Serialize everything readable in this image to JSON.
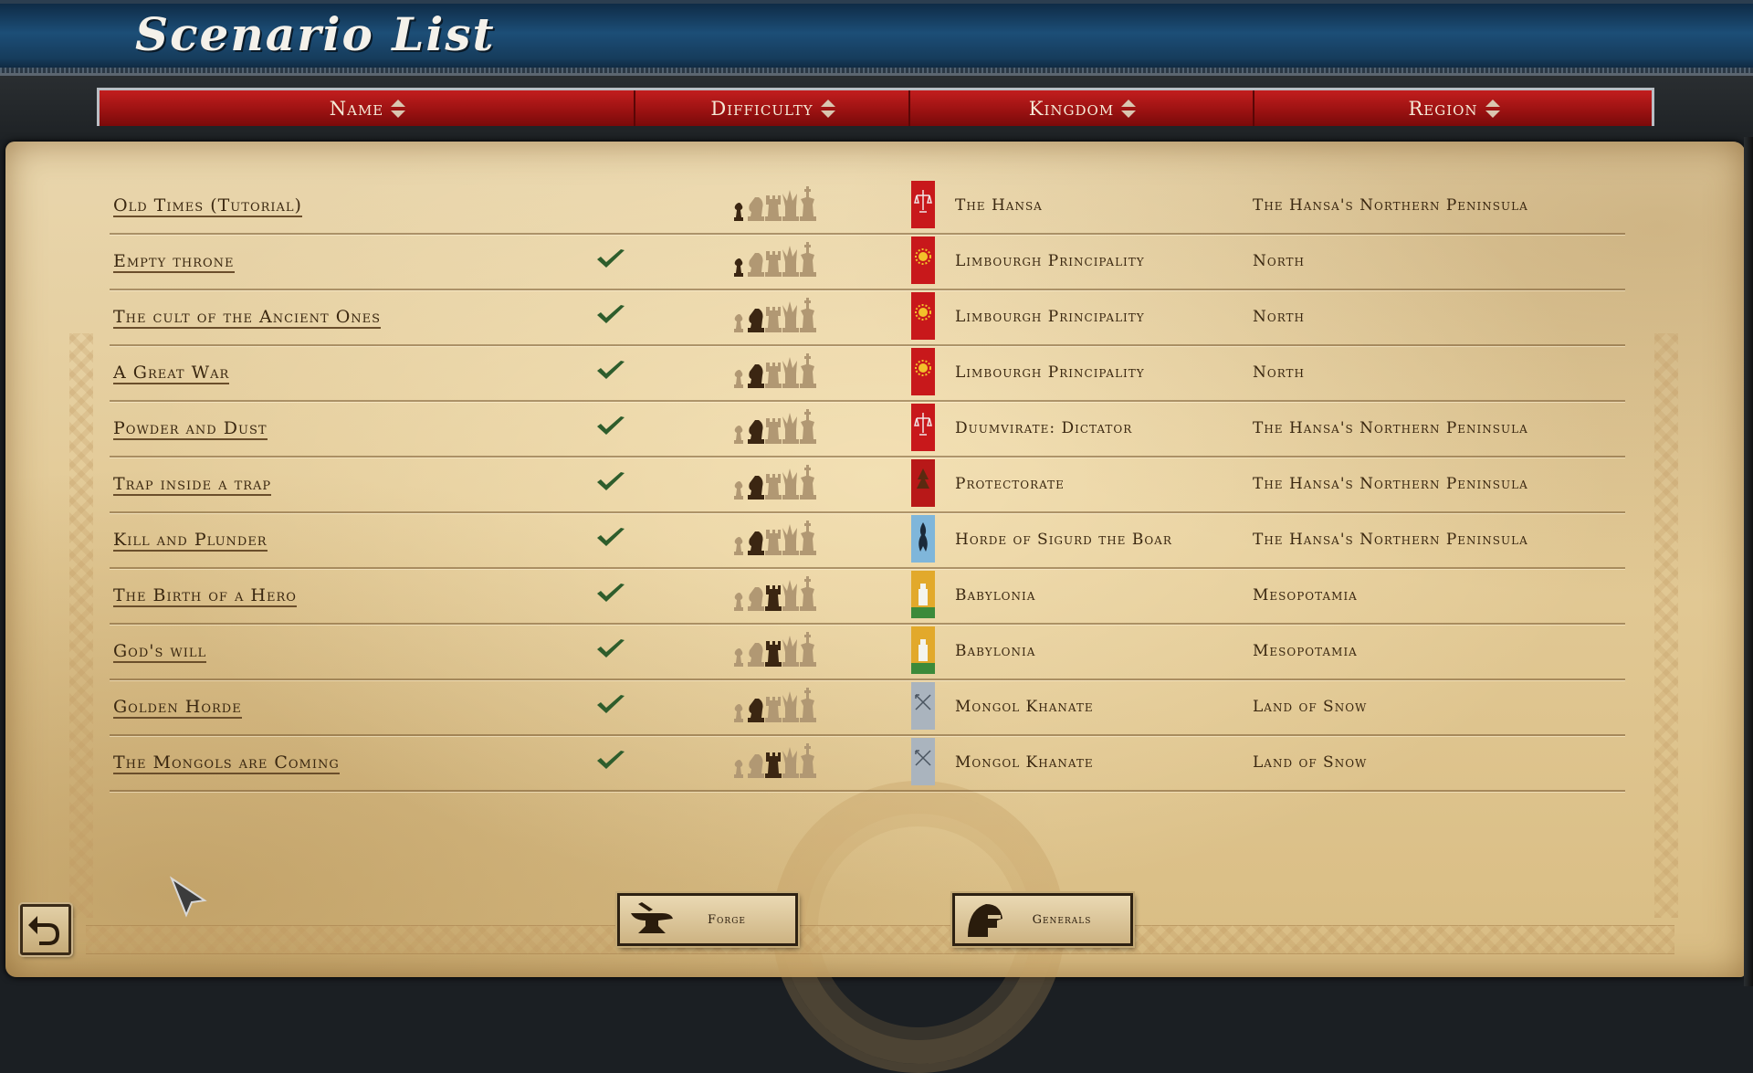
{
  "header": {
    "title": "Scenario List"
  },
  "columns": [
    {
      "label": "Name"
    },
    {
      "label": "Difficulty"
    },
    {
      "label": "Kingdom"
    },
    {
      "label": "Region"
    }
  ],
  "rows": [
    {
      "name": "Old Times (Tutorial)",
      "completed": false,
      "difficulty": 1,
      "banner_color": "#c8181b",
      "banner_icon": "scales-icon",
      "kingdom": "The Hansa",
      "region": "The Hansa's Northern Peninsula"
    },
    {
      "name": "Empty throne",
      "completed": true,
      "difficulty": 1,
      "banner_color": "#c8181b",
      "banner_icon": "sun-icon",
      "kingdom": "Limbourgh Principality",
      "region": "North"
    },
    {
      "name": "The cult of the Ancient Ones",
      "completed": true,
      "difficulty": 2,
      "banner_color": "#c8181b",
      "banner_icon": "sun-icon",
      "kingdom": "Limbourgh Principality",
      "region": "North"
    },
    {
      "name": "A Great War",
      "completed": true,
      "difficulty": 2,
      "banner_color": "#c8181b",
      "banner_icon": "sun-icon",
      "kingdom": "Limbourgh Principality",
      "region": "North"
    },
    {
      "name": "Powder and Dust",
      "completed": true,
      "difficulty": 2,
      "banner_color": "#c8181b",
      "banner_icon": "scales-icon",
      "kingdom": "Duumvirate: Dictator",
      "region": "The Hansa's Northern Peninsula"
    },
    {
      "name": "Trap inside a trap",
      "completed": true,
      "difficulty": 2,
      "banner_color": "#b81818",
      "banner_icon": "tree-icon",
      "kingdom": "Protectorate",
      "region": "The Hansa's Northern Peninsula"
    },
    {
      "name": "Kill and Plunder",
      "completed": true,
      "difficulty": 2,
      "banner_color": "#7fb6da",
      "banner_icon": "boar-icon",
      "kingdom": "Horde of Sigurd the Boar",
      "region": "The Hansa's Northern Peninsula"
    },
    {
      "name": "The Birth of a Hero",
      "completed": true,
      "difficulty": 3,
      "banner_color": "#e2a92b",
      "banner_icon": "tower-icon",
      "kingdom": "Babylonia",
      "region": "Mesopotamia"
    },
    {
      "name": "God's will",
      "completed": true,
      "difficulty": 3,
      "banner_color": "#e2a92b",
      "banner_icon": "tower-icon",
      "kingdom": "Babylonia",
      "region": "Mesopotamia"
    },
    {
      "name": "Golden Horde",
      "completed": true,
      "difficulty": 2,
      "banner_color": "#aab4be",
      "banner_icon": "arrows-icon",
      "kingdom": "Mongol Khanate",
      "region": "Land of Snow"
    },
    {
      "name": "The Mongols are Coming",
      "completed": true,
      "difficulty": 3,
      "banner_color": "#aab4be",
      "banner_icon": "arrows-icon",
      "kingdom": "Mongol Khanate",
      "region": "Land of Snow"
    }
  ],
  "footer": {
    "forge_label": "Forge",
    "forge_icon": "anvil-icon",
    "generals_label": "Generals",
    "generals_icon": "helmet-icon",
    "back_icon": "undo-icon"
  },
  "colors": {
    "check": "#2e5d2c",
    "piece_active": "#3b2612",
    "piece_inactive": "#b19873"
  }
}
